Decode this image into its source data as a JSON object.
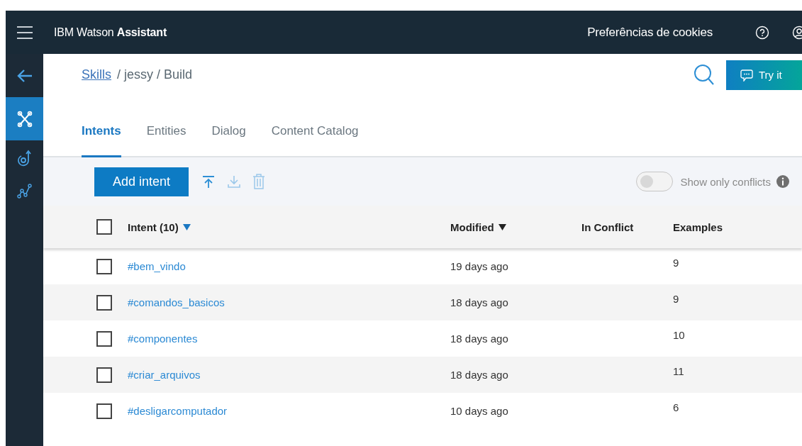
{
  "header": {
    "brand": {
      "prefix": "IBM Watson ",
      "name": "Assistant"
    },
    "cookies_link": "Preferências de cookies"
  },
  "sidebar": {
    "items": [
      {
        "kind": "back",
        "selected": false
      },
      {
        "kind": "build",
        "selected": true
      },
      {
        "kind": "deploy",
        "selected": false
      },
      {
        "kind": "analytics",
        "selected": false
      }
    ]
  },
  "breadcrumb": {
    "link": "Skills",
    "rest": "/ jessy / Build"
  },
  "try_button": "Try it",
  "tabs": [
    {
      "label": "Intents",
      "selected": true
    },
    {
      "label": "Entities",
      "selected": false
    },
    {
      "label": "Dialog",
      "selected": false
    },
    {
      "label": "Content Catalog",
      "selected": false
    }
  ],
  "toolbar": {
    "add_button": "Add intent",
    "conflicts_toggle": {
      "label": "Show only conflicts",
      "on": false
    }
  },
  "table": {
    "all_checked": false,
    "columns": [
      {
        "label": "Intent (10)",
        "sorted": true,
        "color": "#1b78c2"
      },
      {
        "label": "Modified",
        "sorted": true,
        "color": "#222222"
      },
      {
        "label": "In Conflict",
        "sorted": false
      },
      {
        "label": "Examples",
        "sorted": false
      }
    ],
    "rows": [
      {
        "intent": "#bem_vindo",
        "modified": "19 days ago",
        "examples": "9",
        "checked": false
      },
      {
        "intent": "#comandos_basicos",
        "modified": "18 days ago",
        "examples": "9",
        "checked": false
      },
      {
        "intent": "#componentes",
        "modified": "18 days ago",
        "examples": "10",
        "checked": false
      },
      {
        "intent": "#criar_arquivos",
        "modified": "18 days ago",
        "examples": "11",
        "checked": false
      },
      {
        "intent": "#desligarcomputador",
        "modified": "10 days ago",
        "examples": "6",
        "checked": false
      }
    ]
  }
}
